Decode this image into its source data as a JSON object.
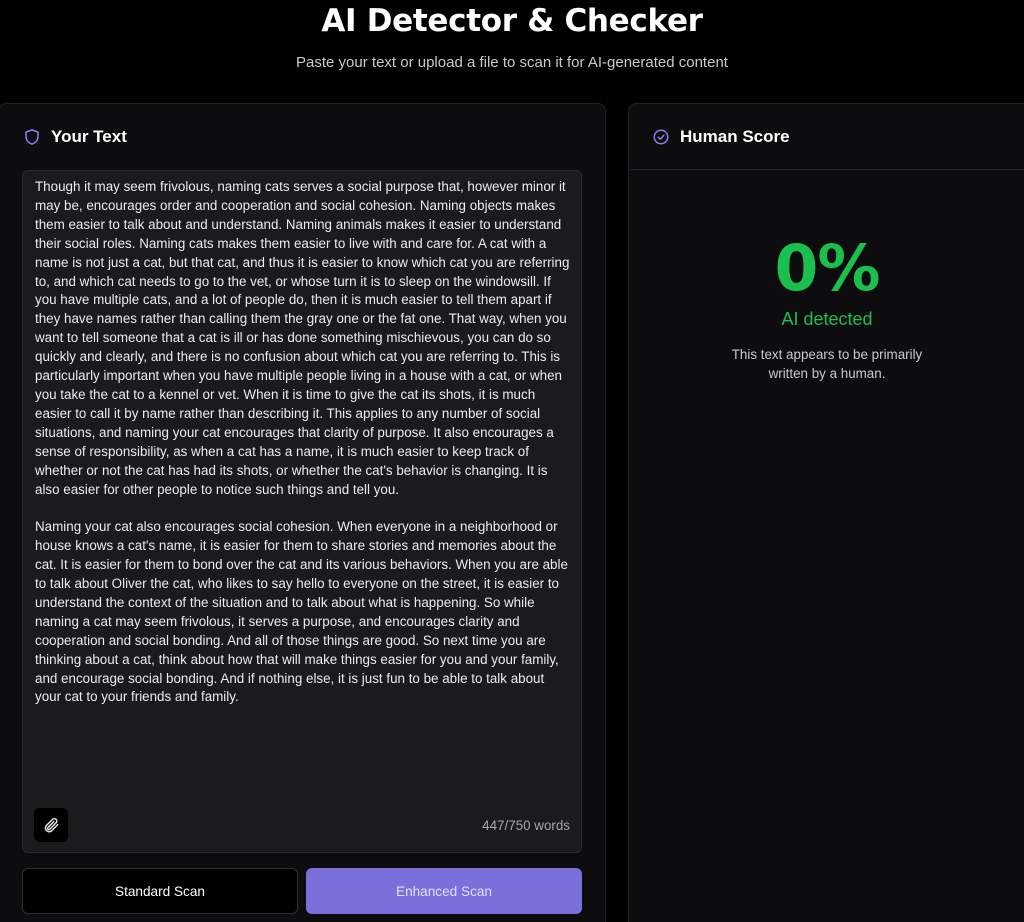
{
  "header": {
    "title": "AI Detector & Checker",
    "subtitle": "Paste your text or upload a file to scan it for AI-generated content"
  },
  "input_panel": {
    "title": "Your Text",
    "title_icon": "shield-icon",
    "paragraphs": [
      "Though it may seem frivolous, naming cats serves a social purpose that, however minor it may be, encourages order and cooperation and social cohesion. Naming objects makes them easier to talk about and understand. Naming animals makes it easier to understand their social roles. Naming cats makes them easier to live with and care for. A cat with a name is not just a cat, but that cat, and thus it is easier to know which cat you are referring to, and which cat needs to go to the vet, or whose turn it is to sleep on the windowsill. If you have multiple cats, and a lot of people do, then it is much easier to tell them apart if they have names rather than calling them the gray one or the fat one. That way, when you want to tell someone that a cat is ill or has done something mischievous, you can do so quickly and clearly, and there is no confusion about which cat you are referring to. This is particularly important when you have multiple people living in a house with a cat, or when you take the cat to a kennel or vet. When it is time to give the cat its shots, it is much easier to call it by name rather than describing it. This applies to any number of social situations, and naming your cat encourages that clarity of purpose. It also encourages a sense of responsibility, as when a cat has a name, it is much easier to keep track of whether or not the cat has had its shots, or whether the cat's behavior is changing. It is also easier for other people to notice such things and tell you.",
      "Naming your cat also encourages social cohesion. When everyone in a neighborhood or house knows a cat's name, it is easier for them to share stories and memories about the cat. It is easier for them to bond over the cat and its various behaviors. When you are able to talk about Oliver the cat, who likes to say hello to everyone on the street, it is easier to understand the context of the situation and to talk about what is happening. So while naming a cat may seem frivolous, it serves a purpose, and encourages clarity and cooperation and social bonding. And all of those things are good. So next time you are thinking about a cat, think about how that will make things easier for you and your family, and encourage social bonding. And if nothing else, it is just fun to be able to talk about your cat to your friends and family."
    ],
    "attach_icon": "paperclip-icon",
    "word_count": "447/750 words",
    "standard_scan_label": "Standard Scan",
    "enhanced_scan_label": "Enhanced Scan"
  },
  "result_panel": {
    "title": "Human Score",
    "title_icon": "check-circle-icon",
    "score": "0%",
    "score_label": "AI detected",
    "description": "This text appears to be primarily written by a human."
  },
  "colors": {
    "background": "#000000",
    "panel": "#0d0d0f",
    "accent": "#7a6fdb",
    "success": "#1bbf4e"
  }
}
